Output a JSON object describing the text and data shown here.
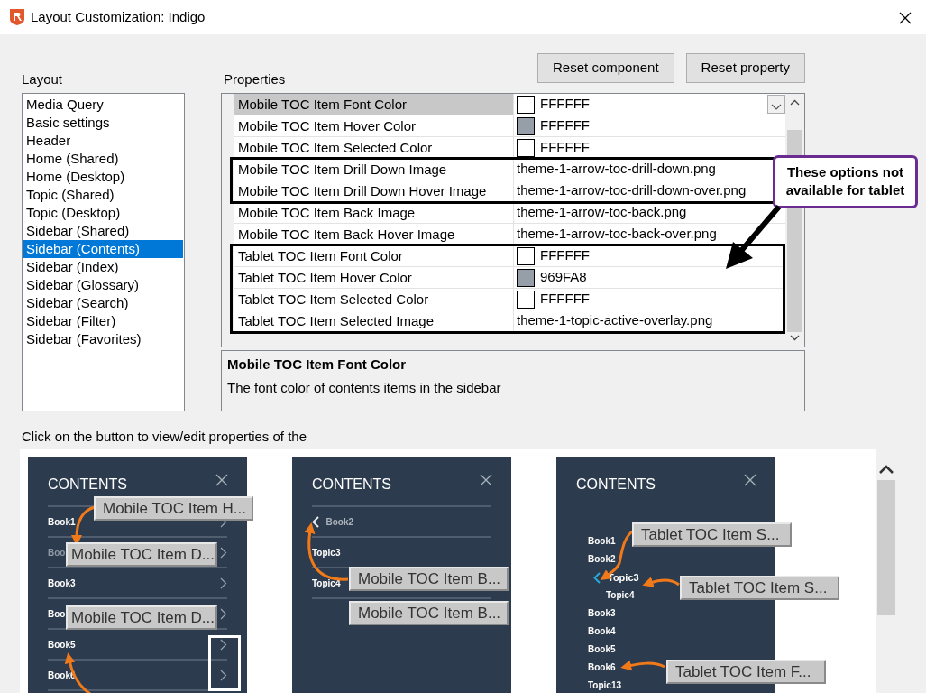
{
  "window": {
    "title": "Layout Customization: Indigo"
  },
  "buttons": [
    {
      "label": "Reset component"
    },
    {
      "label": "Reset property"
    }
  ],
  "layout": {
    "label": "Layout",
    "items": [
      {
        "label": "Media Query",
        "selected": false
      },
      {
        "label": "Basic settings",
        "selected": false
      },
      {
        "label": "Header",
        "selected": false
      },
      {
        "label": "Home (Shared)",
        "selected": false
      },
      {
        "label": "Home (Desktop)",
        "selected": false
      },
      {
        "label": "Topic (Shared)",
        "selected": false
      },
      {
        "label": "Topic (Desktop)",
        "selected": false
      },
      {
        "label": "Sidebar (Shared)",
        "selected": false
      },
      {
        "label": "Sidebar (Contents)",
        "selected": true
      },
      {
        "label": "Sidebar (Index)",
        "selected": false
      },
      {
        "label": "Sidebar (Glossary)",
        "selected": false
      },
      {
        "label": "Sidebar (Search)",
        "selected": false
      },
      {
        "label": "Sidebar (Filter)",
        "selected": false
      },
      {
        "label": "Sidebar (Favorites)",
        "selected": false
      }
    ]
  },
  "properties": {
    "label": "Properties",
    "groups": [
      {
        "boxed": false,
        "rows": [
          {
            "name": "Mobile TOC Item Font Color",
            "value": "FFFFFF",
            "color": "#ffffff",
            "selected": true
          },
          {
            "name": "Mobile TOC Item Hover Color",
            "value": "FFFFFF",
            "color": "#969fa8",
            "selected": false
          },
          {
            "name": "Mobile TOC Item Selected Color",
            "value": "FFFFFF",
            "color": "#ffffff",
            "selected": false
          }
        ]
      },
      {
        "boxed": true,
        "rows": [
          {
            "name": "Mobile TOC Item Drill Down Image",
            "value": "theme-1-arrow-toc-drill-down.png",
            "selected": false
          },
          {
            "name": "Mobile TOC Item Drill Down Hover Image",
            "value": "theme-1-arrow-toc-drill-down-over.png",
            "selected": false
          }
        ]
      },
      {
        "boxed": false,
        "rows": [
          {
            "name": "Mobile TOC Item Back Image",
            "value": "theme-1-arrow-toc-back.png",
            "selected": false
          },
          {
            "name": "Mobile TOC Item Back Hover Image",
            "value": "theme-1-arrow-toc-back-over.png",
            "selected": false
          }
        ]
      },
      {
        "boxed": true,
        "rows": [
          {
            "name": "Tablet TOC Item Font Color",
            "value": "FFFFFF",
            "color": "#ffffff",
            "selected": false
          },
          {
            "name": "Tablet TOC Item Hover Color",
            "value": "969FA8",
            "color": "#969fa8",
            "selected": false
          },
          {
            "name": "Tablet TOC Item Selected Color",
            "value": "FFFFFF",
            "color": "#ffffff",
            "selected": false
          },
          {
            "name": "Tablet TOC Item Selected Image",
            "value": "theme-1-topic-active-overlay.png",
            "selected": false
          }
        ]
      }
    ],
    "description": {
      "title": "Mobile TOC Item Font Color",
      "text": "The font color of contents items in the sidebar"
    }
  },
  "annotation": {
    "text": "These options not available for tablet"
  },
  "preview": {
    "caption": "Click on the button to view/edit properties of the",
    "panels": [
      {
        "kind": "mobile",
        "title": "CONTENTS",
        "items": [
          {
            "label": "Book1",
            "hover": false,
            "boxed": false
          },
          {
            "label": "Boo",
            "hover": true,
            "boxed": false
          },
          {
            "label": "Book3",
            "hover": false,
            "boxed": false
          },
          {
            "label": "Boo",
            "hover": false,
            "boxed": false
          },
          {
            "label": "Book5",
            "hover": false,
            "boxed": true
          },
          {
            "label": "Book6",
            "hover": false,
            "boxed": true
          }
        ],
        "callouts": [
          {
            "label": "Mobile TOC Item H...",
            "arrow": true
          },
          {
            "label": "Mobile TOC Item D...",
            "arrow": false
          },
          {
            "label": "Mobile TOC Item D...",
            "arrow": true
          }
        ]
      },
      {
        "kind": "back",
        "title": "CONTENTS",
        "items": [
          {
            "label": "Book2",
            "kind": "back"
          },
          {
            "label": "Topic3",
            "kind": "topic"
          },
          {
            "label": "Topic4",
            "kind": "topic"
          }
        ],
        "callouts": [
          {
            "label": "Mobile TOC Item B...",
            "arrow": true
          },
          {
            "label": "Mobile TOC Item B...",
            "arrow": false
          }
        ]
      },
      {
        "kind": "tablet",
        "title": "CONTENTS",
        "items": [
          {
            "label": "Book1",
            "kind": "book",
            "selected": false
          },
          {
            "label": "Book2",
            "kind": "book",
            "selected": false
          },
          {
            "label": "Topic3",
            "kind": "topic",
            "selected": true
          },
          {
            "label": "Topic4",
            "kind": "topic",
            "selected": false
          },
          {
            "label": "Book3",
            "kind": "book",
            "selected": false
          },
          {
            "label": "Book4",
            "kind": "book",
            "selected": false
          },
          {
            "label": "Book5",
            "kind": "book",
            "selected": false
          },
          {
            "label": "Book6",
            "kind": "book",
            "selected": false
          },
          {
            "label": "Topic13",
            "kind": "book",
            "selected": false
          }
        ],
        "callouts": [
          {
            "label": "Tablet TOC Item S...",
            "arrow": true
          },
          {
            "label": "Tablet TOC Item S...",
            "arrow": true
          },
          {
            "label": "Tablet TOC Item F...",
            "arrow": true
          }
        ]
      }
    ]
  }
}
